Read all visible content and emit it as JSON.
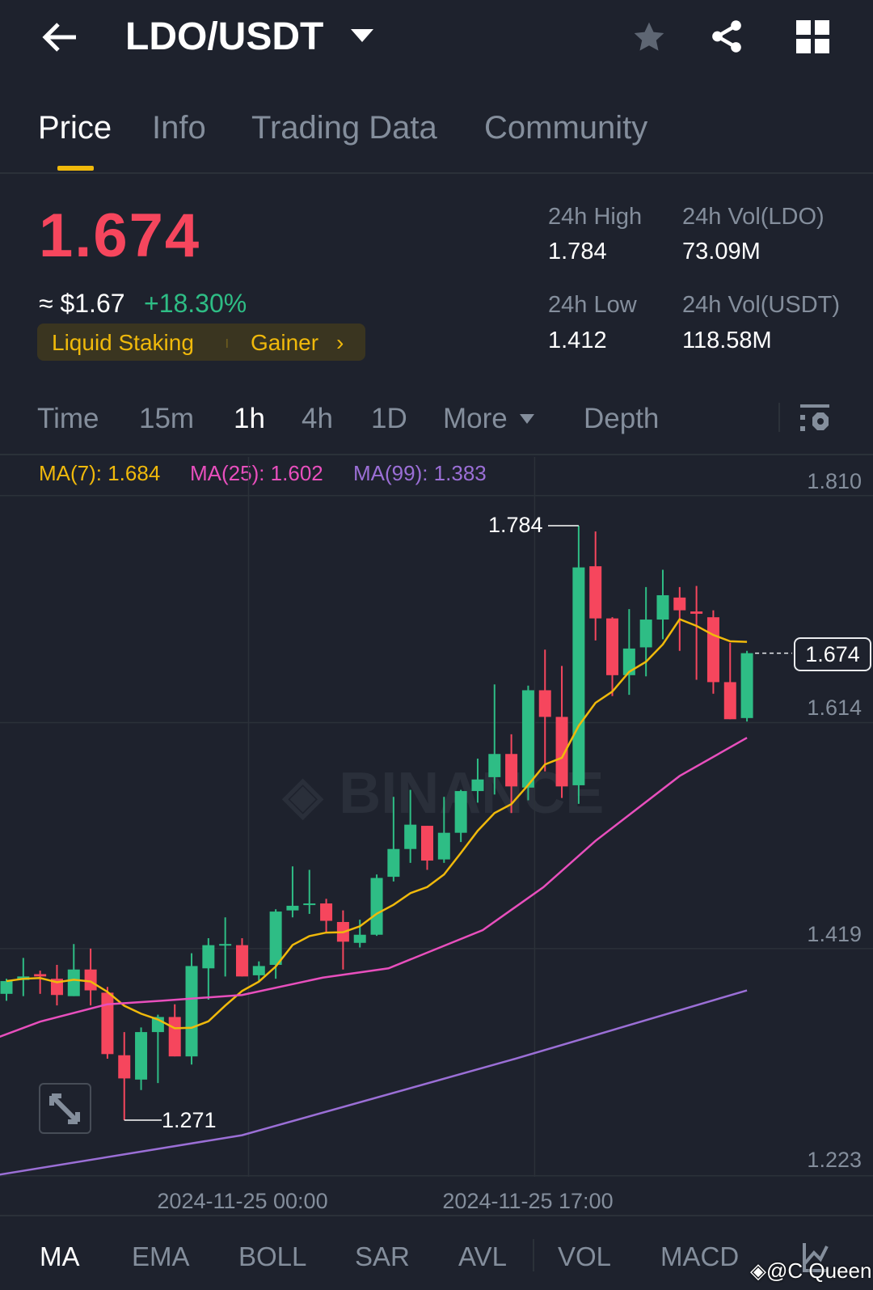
{
  "header": {
    "title": "LDO/USDT",
    "icons": [
      "back-arrow-icon",
      "dropdown-caret-icon",
      "star-icon",
      "share-icon",
      "grid-icon"
    ]
  },
  "tabs": [
    {
      "label": "Price"
    },
    {
      "label": "Info"
    },
    {
      "label": "Trading Data"
    },
    {
      "label": "Community"
    }
  ],
  "ticker": {
    "price": "1.674",
    "fiat": "≈ $1.67",
    "change": "+18.30%",
    "tag1": "Liquid Staking",
    "tag2": "Gainer",
    "high_label": "24h High",
    "high": "1.784",
    "low_label": "24h Low",
    "low": "1.412",
    "vol_base_label": "24h Vol(LDO)",
    "vol_base": "73.09M",
    "vol_quote_label": "24h Vol(USDT)",
    "vol_quote": "118.58M"
  },
  "intervals": [
    "Time",
    "15m",
    "1h",
    "4h",
    "1D",
    "More",
    "Depth"
  ],
  "ma_legend": {
    "ma7": "MA(7): 1.684",
    "ma25": "MA(25): 1.602",
    "ma99": "MA(99): 1.383"
  },
  "indicators": [
    "MA",
    "EMA",
    "BOLL",
    "SAR",
    "AVL",
    "VOL",
    "MACD"
  ],
  "watermark": "BINANCE",
  "user_watermark": "@C Queen",
  "colors": {
    "up": "#2ebd85",
    "down": "#f6465d",
    "ma7": "#f0b90b",
    "ma25": "#e84fbd",
    "ma99": "#9b6fd6",
    "accent": "#f0b90b"
  },
  "chart_data": {
    "type": "candlestick",
    "interval": "1h",
    "y_ticks": [
      "1.810",
      "1.614",
      "1.419",
      "1.223"
    ],
    "x_ticks": [
      "2024-11-25 00:00",
      "2024-11-25 17:00"
    ],
    "x_tick_candle_index": [
      14,
      31
    ],
    "high_annotation": "1.784",
    "low_annotation": "1.271",
    "current_price": "1.674",
    "ylim": [
      1.2,
      1.83
    ],
    "candles": [
      [
        1.38,
        1.393,
        1.374,
        1.391
      ],
      [
        1.392,
        1.411,
        1.378,
        1.395
      ],
      [
        1.397,
        1.4,
        1.38,
        1.395
      ],
      [
        1.393,
        1.405,
        1.37,
        1.379
      ],
      [
        1.378,
        1.423,
        1.378,
        1.401
      ],
      [
        1.401,
        1.419,
        1.37,
        1.383
      ],
      [
        1.381,
        1.386,
        1.324,
        1.328
      ],
      [
        1.327,
        1.347,
        1.271,
        1.307
      ],
      [
        1.306,
        1.351,
        1.297,
        1.347
      ],
      [
        1.347,
        1.362,
        1.303,
        1.36
      ],
      [
        1.36,
        1.371,
        1.326,
        1.326
      ],
      [
        1.326,
        1.415,
        1.319,
        1.404
      ],
      [
        1.402,
        1.428,
        1.375,
        1.422
      ],
      [
        1.422,
        1.446,
        1.395,
        1.423
      ],
      [
        1.422,
        1.428,
        1.395,
        1.395
      ],
      [
        1.396,
        1.408,
        1.391,
        1.404
      ],
      [
        1.405,
        1.453,
        1.393,
        1.451
      ],
      [
        1.452,
        1.49,
        1.446,
        1.456
      ],
      [
        1.457,
        1.487,
        1.449,
        1.458
      ],
      [
        1.458,
        1.462,
        1.433,
        1.443
      ],
      [
        1.442,
        1.452,
        1.401,
        1.425
      ],
      [
        1.424,
        1.444,
        1.42,
        1.431
      ],
      [
        1.431,
        1.483,
        1.43,
        1.48
      ],
      [
        1.481,
        1.55,
        1.477,
        1.505
      ],
      [
        1.505,
        1.556,
        1.493,
        1.526
      ],
      [
        1.525,
        1.525,
        1.487,
        1.495
      ],
      [
        1.496,
        1.55,
        1.493,
        1.519
      ],
      [
        1.519,
        1.556,
        1.511,
        1.555
      ],
      [
        1.555,
        1.583,
        1.545,
        1.565
      ],
      [
        1.567,
        1.647,
        1.552,
        1.587
      ],
      [
        1.587,
        1.604,
        1.536,
        1.559
      ],
      [
        1.558,
        1.646,
        1.547,
        1.642
      ],
      [
        1.642,
        1.677,
        1.572,
        1.619
      ],
      [
        1.619,
        1.663,
        1.549,
        1.559
      ],
      [
        1.56,
        1.784,
        1.544,
        1.748
      ],
      [
        1.749,
        1.779,
        1.685,
        1.704
      ],
      [
        1.704,
        1.705,
        1.637,
        1.655
      ],
      [
        1.655,
        1.712,
        1.638,
        1.678
      ],
      [
        1.679,
        1.731,
        1.654,
        1.703
      ],
      [
        1.703,
        1.746,
        1.686,
        1.724
      ],
      [
        1.722,
        1.731,
        1.676,
        1.711
      ],
      [
        1.71,
        1.732,
        1.651,
        1.708
      ],
      [
        1.705,
        1.711,
        1.639,
        1.649
      ],
      [
        1.649,
        1.683,
        1.617,
        1.617
      ],
      [
        1.618,
        1.676,
        1.615,
        1.674
      ]
    ],
    "ma25_points": [
      [
        -0.4,
        1.343
      ],
      [
        2,
        1.356
      ],
      [
        6,
        1.371
      ],
      [
        9.2,
        1.374
      ],
      [
        14,
        1.379
      ],
      [
        18.8,
        1.394
      ],
      [
        22.7,
        1.402
      ],
      [
        28.3,
        1.435
      ],
      [
        31.9,
        1.472
      ],
      [
        35,
        1.512
      ],
      [
        40,
        1.568
      ],
      [
        44,
        1.601
      ]
    ],
    "ma99_points": [
      [
        -0.4,
        1.224
      ],
      [
        14,
        1.258
      ],
      [
        30,
        1.323
      ],
      [
        44,
        1.383
      ]
    ]
  }
}
